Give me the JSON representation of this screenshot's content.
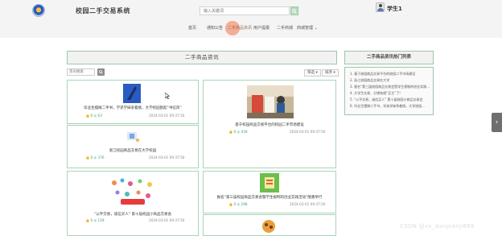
{
  "header": {
    "site_title": "校园二手交易系统",
    "search_placeholder": "输入关键词",
    "user_name": "学生1"
  },
  "nav": {
    "items": [
      "首页",
      "通知公告",
      "二手商品资讯",
      "用户提报",
      "二手商城",
      "商城管理"
    ]
  },
  "main": {
    "panel_title": "二手商品资讯",
    "filter_placeholder": "资讯搜索",
    "sort_options": [
      "筛选",
      "排序"
    ],
    "cards": [
      {
        "title": "毕业生摆摊二手书，学弟学妹争着挑，大学校园刮起“书信风”",
        "likes": "0",
        "views": "63",
        "date": "2024-03-01 09:37:50"
      },
      {
        "title": "浙江校园商品交易在大学校园",
        "likes": "0",
        "views": "376",
        "date": "2024-03-01 09:37:50"
      },
      {
        "title": "基于校园商品交易平台的校园二手市场建设",
        "likes": "0",
        "views": "418",
        "date": "2024-03-01 09:37:50"
      },
      {
        "title": "“公平交易，诚信买人” 第十届校园小商品交易会",
        "likes": "0",
        "views": "159",
        "date": "2024-03-01 09:37:50"
      },
      {
        "title": "报名“第三届校园商品交易会暨学生规制的创业实践活动”隆重举行",
        "likes": "0",
        "views": "298",
        "date": "2024-03-01 09:37:50"
      }
    ]
  },
  "sidebar": {
    "title": "二手商品资讯热门列表",
    "items": [
      "1. 基于校园商品交易平台的校园二手市场建设",
      "2. 浙江校园商品交易在大学",
      "3. 报名“第三届校园商品交易会暨学生规制的创业实践...",
      "4. 大学生交易、分销有限“买主”了!",
      "5. “公平交易，诚信买人” 第十届校园小商品交易会",
      "6. 毕业生摆摊二手书，学弟学妹争着挑，大学校园..."
    ]
  },
  "watermark": "CSDN @vx_danpianji889",
  "colors": {
    "accent_green": "#9cc6a8",
    "nav_highlight": "#f4a58c",
    "meta_green": "#4aa06a"
  }
}
